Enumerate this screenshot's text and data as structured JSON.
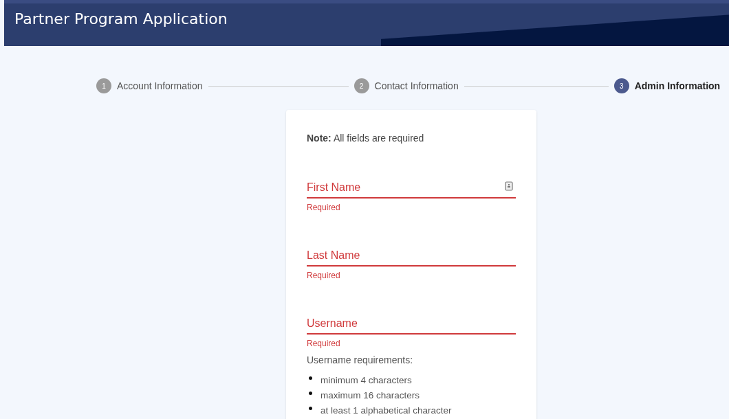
{
  "header": {
    "title": "Partner Program Application"
  },
  "steps": [
    {
      "number": "1",
      "label": "Account Information",
      "selected": false
    },
    {
      "number": "2",
      "label": "Contact Information",
      "selected": false
    },
    {
      "number": "3",
      "label": "Admin Information",
      "selected": true
    }
  ],
  "form": {
    "note": "**Note:** All fields are required",
    "fields": [
      {
        "placeholder": "First Name",
        "error": true,
        "message": "Required",
        "has_icon": true
      },
      {
        "placeholder": "Last Name",
        "error": true,
        "message": "Required",
        "has_icon": false
      },
      {
        "placeholder": "Username",
        "error": true,
        "message": "Required",
        "has_icon": false
      }
    ],
    "requirements_title": "Username requirements:",
    "requirements": [
      "minimum 4 characters",
      "maximum 16 characters",
      "at least 1 alphabetical character"
    ]
  }
}
